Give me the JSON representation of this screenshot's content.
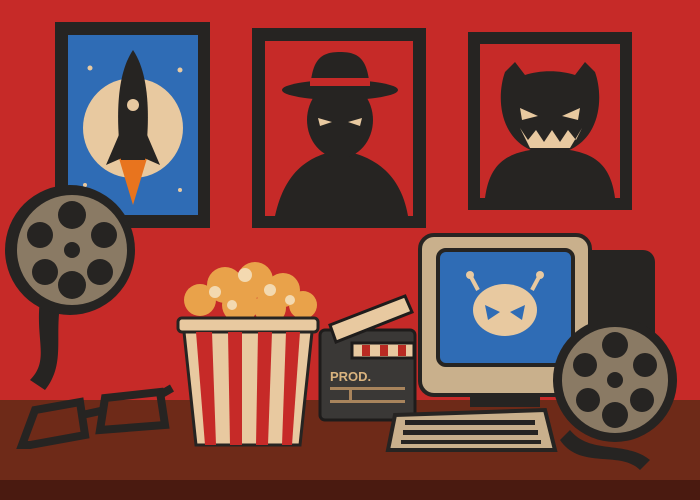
{
  "scene": {
    "clapperboard_label": "PROD."
  },
  "colors": {
    "wall": "#c62a28",
    "shelf": "#6e2a18",
    "dark": "#262422",
    "cream": "#e8c9a0",
    "blue": "#2f6cb5",
    "tan": "#8a7a64"
  }
}
